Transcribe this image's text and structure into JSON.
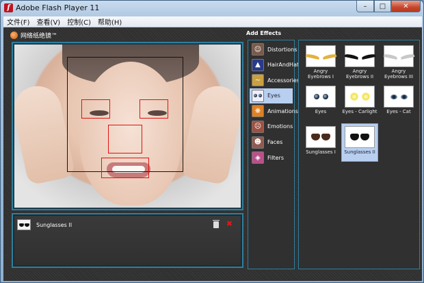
{
  "window": {
    "title": "Adobe Flash Player 11",
    "min": "–",
    "max": "□",
    "close": "✕"
  },
  "menu": [
    "文件(F)",
    "查看(V)",
    "控制(C)",
    "帮助(H)"
  ],
  "app": {
    "brand": "网络纸绝镜™",
    "effects_title": "Add Effects"
  },
  "layers": [
    {
      "label": "Sunglasses II"
    }
  ],
  "categories": [
    {
      "label": "Distortions",
      "icon": "face-portrait-icon",
      "color": "#7a5a4a"
    },
    {
      "label": "HairAndHat",
      "icon": "hat-icon",
      "color": "#2a3a8a"
    },
    {
      "label": "Accessories",
      "icon": "mustache-icon",
      "color": "#caa040"
    },
    {
      "label": "Eyes",
      "icon": "eyes-icon",
      "color": "#1e2e3e",
      "active": true
    },
    {
      "label": "Animations",
      "icon": "butterfly-icon",
      "color": "#e08020"
    },
    {
      "label": "Emotions",
      "icon": "emotion-face-icon",
      "color": "#a05040"
    },
    {
      "label": "Faces",
      "icon": "face-icon",
      "color": "#905a50"
    },
    {
      "label": "Filters",
      "icon": "filter-icon",
      "color": "#b8508a"
    }
  ],
  "items": [
    {
      "label": "Angry Eyebrows I",
      "kind": "brow",
      "color": "#e3b23c"
    },
    {
      "label": "Angry Eyebrows II",
      "kind": "brow",
      "color": "#111111"
    },
    {
      "label": "Angry Eyebrows III",
      "kind": "brow",
      "color": "#cccccc"
    },
    {
      "label": "Eyes",
      "kind": "eyes"
    },
    {
      "label": "Eyes - Carlight",
      "kind": "carlight"
    },
    {
      "label": "Eyes - Cat",
      "kind": "cat"
    },
    {
      "label": "Sunglasses I",
      "kind": "glasses-brown"
    },
    {
      "label": "Sunglasses II",
      "kind": "glasses",
      "active": true
    }
  ]
}
